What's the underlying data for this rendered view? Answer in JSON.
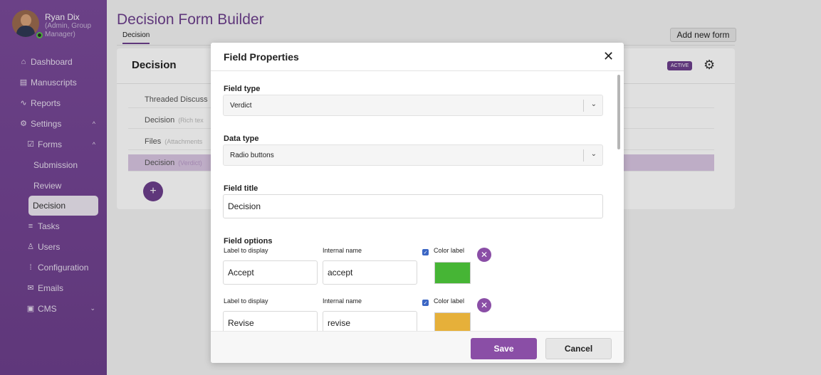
{
  "user": {
    "name": "Ryan Dix",
    "role": "(Admin, Group Manager)"
  },
  "sidebar": {
    "items": [
      {
        "icon": "⌂",
        "label": "Dashboard"
      },
      {
        "icon": "▤",
        "label": "Manuscripts"
      },
      {
        "icon": "∿",
        "label": "Reports"
      },
      {
        "icon": "⚙",
        "label": "Settings",
        "chevron": "^"
      },
      {
        "icon": "☑",
        "label": "Forms",
        "chevron": "^"
      },
      {
        "label": "Submission"
      },
      {
        "label": "Review"
      },
      {
        "label": "Decision"
      },
      {
        "icon": "≡",
        "label": "Tasks"
      },
      {
        "icon": "♙",
        "label": "Users"
      },
      {
        "icon": "⁞",
        "label": "Configuration"
      },
      {
        "icon": "✉",
        "label": "Emails"
      },
      {
        "icon": "▣",
        "label": "CMS",
        "chevron": "⌄"
      }
    ]
  },
  "header": {
    "title": "Decision Form Builder",
    "tab": "Decision",
    "add_form": "Add new form"
  },
  "card": {
    "title": "Decision",
    "badge": "ACTIVE",
    "rows": [
      {
        "label": "Threaded Discuss",
        "kind": ""
      },
      {
        "label": "Decision",
        "kind": "(Rich tex"
      },
      {
        "label": "Files",
        "kind": "(Attachments"
      },
      {
        "label": "Decision",
        "kind": "(Verdict)"
      }
    ],
    "add_symbol": "+"
  },
  "modal": {
    "title": "Field Properties",
    "close": "✕",
    "field_type_label": "Field type",
    "field_type_value": "Verdict",
    "data_type_label": "Data type",
    "data_type_value": "Radio buttons",
    "field_title_label": "Field title",
    "field_title_value": "Decision",
    "field_options_label": "Field options",
    "col_display": "Label to display",
    "col_internal": "Internal name",
    "col_color": "Color label",
    "options": [
      {
        "display": "Accept",
        "internal": "accept",
        "color": "#46b535"
      },
      {
        "display": "Revise",
        "internal": "revise",
        "color": "#e6b03a"
      }
    ],
    "save": "Save",
    "cancel": "Cancel"
  },
  "colors": {
    "brand": "#6d3f8c",
    "accent": "#8a4ea6"
  }
}
